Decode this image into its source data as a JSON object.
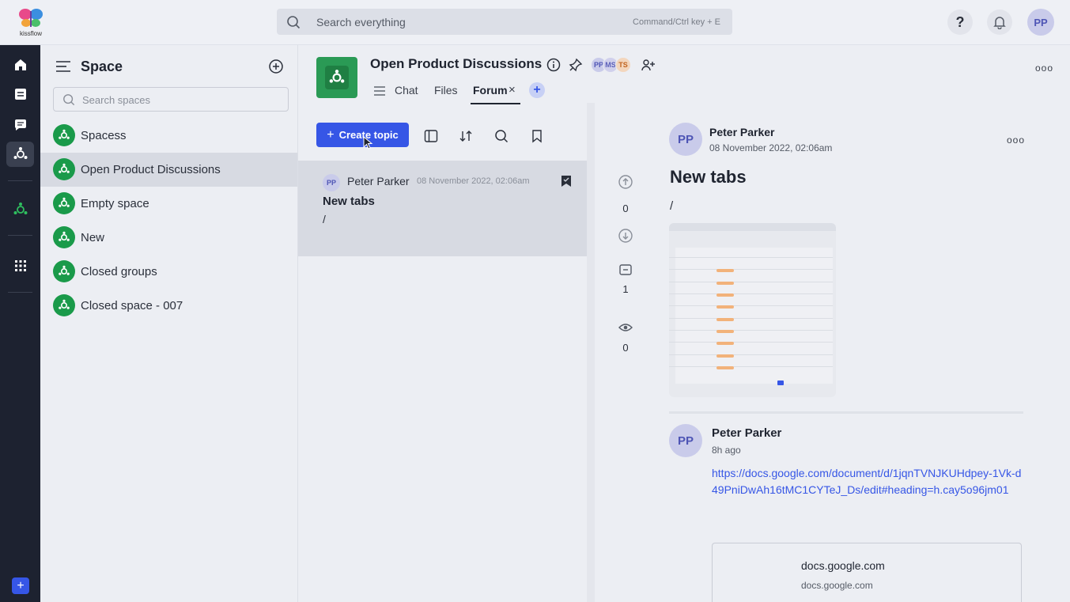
{
  "app": {
    "logo_text": "kissflow",
    "search_placeholder": "Search everything",
    "search_hint": "Command/Ctrl key + E",
    "user_initials": "PP",
    "help_label": "?"
  },
  "sidebar": {
    "title": "Space",
    "search_placeholder": "Search spaces",
    "items": [
      {
        "label": "Spacess"
      },
      {
        "label": "Open Product Discussions"
      },
      {
        "label": "Empty space"
      },
      {
        "label": "New"
      },
      {
        "label": "Closed groups"
      },
      {
        "label": "Closed space - 007"
      }
    ]
  },
  "space": {
    "title": "Open Product Discussions",
    "members": [
      "PP",
      "MS",
      "TS"
    ],
    "tabs": [
      {
        "label": "Chat"
      },
      {
        "label": "Files"
      },
      {
        "label": "Forum"
      }
    ],
    "close_glyph": "×",
    "add_tab_glyph": "+",
    "more_glyph": "ooo"
  },
  "forum": {
    "create_label": "Create topic",
    "create_glyph": "+",
    "topic": {
      "author_initials": "PP",
      "author": "Peter Parker",
      "date": "08 November 2022, 02:06am",
      "title": "New tabs",
      "body": "/"
    }
  },
  "detail": {
    "author_initials": "PP",
    "author": "Peter Parker",
    "date": "08 November 2022, 02:06am",
    "title": "New tabs",
    "body": "/",
    "upvotes": "0",
    "comments": "1",
    "views": "0",
    "more_glyph": "ooo",
    "reply": {
      "author_initials": "PP",
      "author": "Peter Parker",
      "time": "8h ago",
      "link": "https://docs.google.com/document/d/1jqnTVNJKUHdpey-1Vk-d49PniDwAh16tMC1CYTeJ_Ds/edit#heading=h.cay5o96jm01",
      "preview_title": "docs.google.com",
      "preview_sub": "docs.google.com"
    }
  },
  "colors": {
    "accent": "#3656e6",
    "space_green": "#1a9a4a",
    "rail": "#1d2230"
  }
}
